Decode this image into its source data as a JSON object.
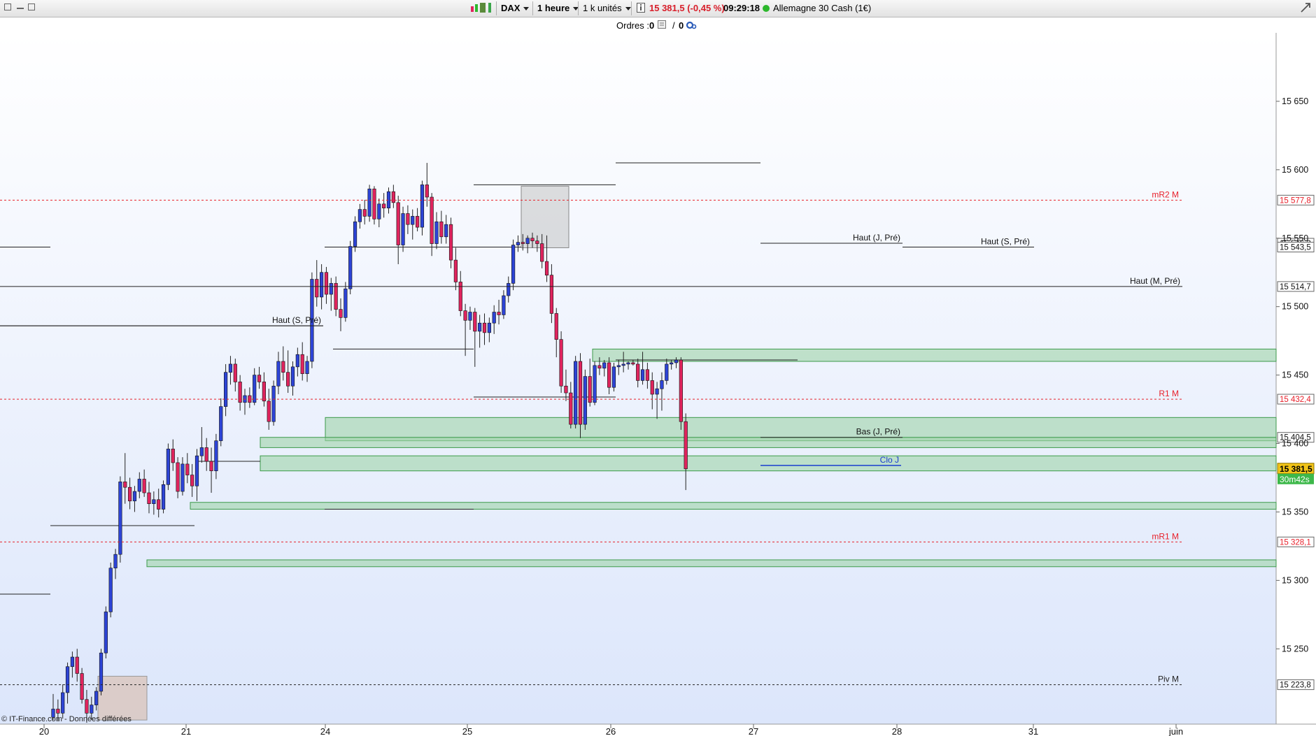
{
  "toolbar": {
    "symbol": "DAX",
    "timeframe": "1 heure",
    "units": "1 k unités",
    "price_change": "15 381,5 (-0,45 %)",
    "time": "09:29:18",
    "instrument": "Allemagne 30 Cash (1€)"
  },
  "orders": {
    "label": "Ordres :",
    "count1": "0",
    "slash": "/",
    "count2": "0"
  },
  "footer": {
    "copyright": "© IT-Finance.com - Données différées"
  },
  "colors": {
    "bull": "#2d44d6",
    "bear": "#e0245e",
    "zone": "#9fd4a8",
    "pivot_red": "#e8202a",
    "blue_line": "#1a3ecf"
  },
  "chart_data": {
    "type": "candlestick",
    "title": "",
    "ylim": [
      15195,
      15700
    ],
    "y_ticks": [
      15250,
      15300,
      15350,
      15400,
      15450,
      15500,
      15550,
      15600,
      15650
    ],
    "y_tick_labels": [
      "15 250",
      "15 300",
      "15 350",
      "15 400",
      "15 450",
      "15 500",
      "15 550",
      "15 600",
      "15 650"
    ],
    "x_tick_labels": [
      "20",
      "21",
      "24",
      "25",
      "26",
      "27",
      "28",
      "31",
      "juin"
    ],
    "current_price": {
      "value": 15381.5,
      "label": "15 381,5",
      "timer": "30m42s"
    },
    "levels": [
      {
        "name": "mR2 M",
        "value": 15577.8,
        "label": "15 577,8",
        "style": "pivot"
      },
      {
        "name": "R1 M",
        "value": 15432.4,
        "label": "15 432,4",
        "style": "pivot"
      },
      {
        "name": "mR1 M",
        "value": 15328.1,
        "label": "15 328,1",
        "style": "pivot"
      },
      {
        "name": "Piv M",
        "value": 15223.8,
        "label": "15 223,8",
        "style": "pivot_black"
      },
      {
        "name": "Haut (J, Pré)",
        "value": 15546.3,
        "label": "15 546,3",
        "style": "line"
      },
      {
        "name": "Haut (S, Pré)",
        "value": 15543.5,
        "label": "15 543,5",
        "style": "line"
      },
      {
        "name": "Haut (M, Pré)",
        "value": 15514.7,
        "label": "15 514,7",
        "style": "line"
      },
      {
        "name": "Haut (S, Pré)",
        "value": 15486,
        "label": "",
        "style": "line"
      },
      {
        "name": "Bas (J, Pré)",
        "value": 15404.5,
        "label": "15 404,5",
        "style": "line"
      },
      {
        "name": "Clo J",
        "value": 15384,
        "label": "",
        "style": "blue"
      }
    ],
    "candles": [
      {
        "o": 15200,
        "h": 15217,
        "l": 15198,
        "c": 15206
      },
      {
        "o": 15206,
        "h": 15213,
        "l": 15197,
        "c": 15203
      },
      {
        "o": 15203,
        "h": 15224,
        "l": 15199,
        "c": 15218
      },
      {
        "o": 15218,
        "h": 15240,
        "l": 15210,
        "c": 15237
      },
      {
        "o": 15237,
        "h": 15248,
        "l": 15229,
        "c": 15244
      },
      {
        "o": 15244,
        "h": 15250,
        "l": 15226,
        "c": 15232
      },
      {
        "o": 15232,
        "h": 15236,
        "l": 15210,
        "c": 15213
      },
      {
        "o": 15213,
        "h": 15220,
        "l": 15196,
        "c": 15203
      },
      {
        "o": 15203,
        "h": 15215,
        "l": 15198,
        "c": 15209
      },
      {
        "o": 15209,
        "h": 15222,
        "l": 15205,
        "c": 15219
      },
      {
        "o": 15219,
        "h": 15250,
        "l": 15216,
        "c": 15247
      },
      {
        "o": 15247,
        "h": 15281,
        "l": 15243,
        "c": 15277
      },
      {
        "o": 15277,
        "h": 15313,
        "l": 15273,
        "c": 15309
      },
      {
        "o": 15309,
        "h": 15323,
        "l": 15301,
        "c": 15319
      },
      {
        "o": 15319,
        "h": 15376,
        "l": 15313,
        "c": 15372
      },
      {
        "o": 15372,
        "h": 15393,
        "l": 15356,
        "c": 15368
      },
      {
        "o": 15368,
        "h": 15375,
        "l": 15352,
        "c": 15358
      },
      {
        "o": 15358,
        "h": 15369,
        "l": 15350,
        "c": 15365
      },
      {
        "o": 15365,
        "h": 15379,
        "l": 15360,
        "c": 15374
      },
      {
        "o": 15374,
        "h": 15381,
        "l": 15361,
        "c": 15364
      },
      {
        "o": 15364,
        "h": 15372,
        "l": 15349,
        "c": 15356
      },
      {
        "o": 15356,
        "h": 15365,
        "l": 15348,
        "c": 15359
      },
      {
        "o": 15359,
        "h": 15367,
        "l": 15346,
        "c": 15352
      },
      {
        "o": 15352,
        "h": 15373,
        "l": 15349,
        "c": 15370
      },
      {
        "o": 15370,
        "h": 15400,
        "l": 15366,
        "c": 15396
      },
      {
        "o": 15396,
        "h": 15403,
        "l": 15380,
        "c": 15386
      },
      {
        "o": 15386,
        "h": 15390,
        "l": 15360,
        "c": 15365
      },
      {
        "o": 15365,
        "h": 15390,
        "l": 15362,
        "c": 15385
      },
      {
        "o": 15385,
        "h": 15393,
        "l": 15371,
        "c": 15377
      },
      {
        "o": 15377,
        "h": 15385,
        "l": 15361,
        "c": 15369
      },
      {
        "o": 15369,
        "h": 15396,
        "l": 15358,
        "c": 15391
      },
      {
        "o": 15391,
        "h": 15412,
        "l": 15386,
        "c": 15397
      },
      {
        "o": 15397,
        "h": 15404,
        "l": 15380,
        "c": 15387
      },
      {
        "o": 15387,
        "h": 15397,
        "l": 15364,
        "c": 15380
      },
      {
        "o": 15380,
        "h": 15407,
        "l": 15374,
        "c": 15402
      },
      {
        "o": 15402,
        "h": 15433,
        "l": 15398,
        "c": 15427
      },
      {
        "o": 15427,
        "h": 15458,
        "l": 15420,
        "c": 15452
      },
      {
        "o": 15452,
        "h": 15464,
        "l": 15443,
        "c": 15458
      },
      {
        "o": 15458,
        "h": 15462,
        "l": 15438,
        "c": 15445
      },
      {
        "o": 15445,
        "h": 15450,
        "l": 15424,
        "c": 15430
      },
      {
        "o": 15430,
        "h": 15440,
        "l": 15421,
        "c": 15435
      },
      {
        "o": 15435,
        "h": 15441,
        "l": 15426,
        "c": 15430
      },
      {
        "o": 15430,
        "h": 15455,
        "l": 15428,
        "c": 15450
      },
      {
        "o": 15450,
        "h": 15456,
        "l": 15440,
        "c": 15445
      },
      {
        "o": 15445,
        "h": 15452,
        "l": 15427,
        "c": 15431
      },
      {
        "o": 15431,
        "h": 15440,
        "l": 15410,
        "c": 15416
      },
      {
        "o": 15416,
        "h": 15446,
        "l": 15413,
        "c": 15442
      },
      {
        "o": 15442,
        "h": 15467,
        "l": 15436,
        "c": 15460
      },
      {
        "o": 15460,
        "h": 15471,
        "l": 15446,
        "c": 15452
      },
      {
        "o": 15452,
        "h": 15468,
        "l": 15437,
        "c": 15442
      },
      {
        "o": 15442,
        "h": 15460,
        "l": 15435,
        "c": 15456
      },
      {
        "o": 15456,
        "h": 15470,
        "l": 15449,
        "c": 15465
      },
      {
        "o": 15465,
        "h": 15474,
        "l": 15446,
        "c": 15451
      },
      {
        "o": 15451,
        "h": 15464,
        "l": 15445,
        "c": 15460
      },
      {
        "o": 15460,
        "h": 15525,
        "l": 15455,
        "c": 15520
      },
      {
        "o": 15520,
        "h": 15534,
        "l": 15500,
        "c": 15507
      },
      {
        "o": 15507,
        "h": 15531,
        "l": 15498,
        "c": 15525
      },
      {
        "o": 15525,
        "h": 15529,
        "l": 15502,
        "c": 15509
      },
      {
        "o": 15509,
        "h": 15521,
        "l": 15497,
        "c": 15517
      },
      {
        "o": 15517,
        "h": 15522,
        "l": 15493,
        "c": 15498
      },
      {
        "o": 15498,
        "h": 15506,
        "l": 15482,
        "c": 15492
      },
      {
        "o": 15492,
        "h": 15518,
        "l": 15489,
        "c": 15513
      },
      {
        "o": 15513,
        "h": 15548,
        "l": 15509,
        "c": 15544
      },
      {
        "o": 15544,
        "h": 15566,
        "l": 15540,
        "c": 15562
      },
      {
        "o": 15562,
        "h": 15575,
        "l": 15557,
        "c": 15571
      },
      {
        "o": 15571,
        "h": 15578,
        "l": 15560,
        "c": 15566
      },
      {
        "o": 15566,
        "h": 15589,
        "l": 15562,
        "c": 15586
      },
      {
        "o": 15586,
        "h": 15588,
        "l": 15560,
        "c": 15564
      },
      {
        "o": 15564,
        "h": 15579,
        "l": 15558,
        "c": 15575
      },
      {
        "o": 15575,
        "h": 15583,
        "l": 15565,
        "c": 15572
      },
      {
        "o": 15572,
        "h": 15587,
        "l": 15568,
        "c": 15584
      },
      {
        "o": 15584,
        "h": 15589,
        "l": 15572,
        "c": 15576
      },
      {
        "o": 15576,
        "h": 15581,
        "l": 15531,
        "c": 15545
      },
      {
        "o": 15545,
        "h": 15573,
        "l": 15540,
        "c": 15568
      },
      {
        "o": 15568,
        "h": 15574,
        "l": 15553,
        "c": 15560
      },
      {
        "o": 15560,
        "h": 15571,
        "l": 15549,
        "c": 15566
      },
      {
        "o": 15566,
        "h": 15572,
        "l": 15555,
        "c": 15558
      },
      {
        "o": 15558,
        "h": 15592,
        "l": 15552,
        "c": 15589
      },
      {
        "o": 15589,
        "h": 15605,
        "l": 15573,
        "c": 15580
      },
      {
        "o": 15580,
        "h": 15583,
        "l": 15537,
        "c": 15546
      },
      {
        "o": 15546,
        "h": 15569,
        "l": 15542,
        "c": 15562
      },
      {
        "o": 15562,
        "h": 15570,
        "l": 15546,
        "c": 15551
      },
      {
        "o": 15551,
        "h": 15567,
        "l": 15546,
        "c": 15560
      },
      {
        "o": 15560,
        "h": 15565,
        "l": 15528,
        "c": 15534
      },
      {
        "o": 15534,
        "h": 15543,
        "l": 15512,
        "c": 15518
      },
      {
        "o": 15518,
        "h": 15526,
        "l": 15493,
        "c": 15497
      },
      {
        "o": 15497,
        "h": 15502,
        "l": 15464,
        "c": 15490
      },
      {
        "o": 15490,
        "h": 15500,
        "l": 15483,
        "c": 15496
      },
      {
        "o": 15496,
        "h": 15499,
        "l": 15456,
        "c": 15482
      },
      {
        "o": 15482,
        "h": 15494,
        "l": 15470,
        "c": 15488
      },
      {
        "o": 15488,
        "h": 15495,
        "l": 15472,
        "c": 15481
      },
      {
        "o": 15481,
        "h": 15492,
        "l": 15474,
        "c": 15488
      },
      {
        "o": 15488,
        "h": 15501,
        "l": 15480,
        "c": 15496
      },
      {
        "o": 15496,
        "h": 15505,
        "l": 15487,
        "c": 15494
      },
      {
        "o": 15494,
        "h": 15512,
        "l": 15491,
        "c": 15508
      },
      {
        "o": 15508,
        "h": 15522,
        "l": 15503,
        "c": 15517
      },
      {
        "o": 15517,
        "h": 15549,
        "l": 15512,
        "c": 15545
      },
      {
        "o": 15545,
        "h": 15552,
        "l": 15540,
        "c": 15547
      },
      {
        "o": 15547,
        "h": 15553,
        "l": 15541,
        "c": 15546
      },
      {
        "o": 15546,
        "h": 15552,
        "l": 15539,
        "c": 15550
      },
      {
        "o": 15550,
        "h": 15554,
        "l": 15543,
        "c": 15548
      },
      {
        "o": 15548,
        "h": 15552,
        "l": 15540,
        "c": 15546
      },
      {
        "o": 15546,
        "h": 15553,
        "l": 15528,
        "c": 15533
      },
      {
        "o": 15533,
        "h": 15552,
        "l": 15518,
        "c": 15523
      },
      {
        "o": 15523,
        "h": 15531,
        "l": 15488,
        "c": 15495
      },
      {
        "o": 15495,
        "h": 15499,
        "l": 15463,
        "c": 15476
      },
      {
        "o": 15476,
        "h": 15482,
        "l": 15437,
        "c": 15442
      },
      {
        "o": 15442,
        "h": 15454,
        "l": 15431,
        "c": 15437
      },
      {
        "o": 15437,
        "h": 15445,
        "l": 15411,
        "c": 15414
      },
      {
        "o": 15414,
        "h": 15464,
        "l": 15411,
        "c": 15460
      },
      {
        "o": 15460,
        "h": 15466,
        "l": 15404,
        "c": 15414
      },
      {
        "o": 15414,
        "h": 15454,
        "l": 15410,
        "c": 15449
      },
      {
        "o": 15449,
        "h": 15462,
        "l": 15427,
        "c": 15430
      },
      {
        "o": 15430,
        "h": 15460,
        "l": 15428,
        "c": 15457
      },
      {
        "o": 15457,
        "h": 15463,
        "l": 15450,
        "c": 15455
      },
      {
        "o": 15455,
        "h": 15461,
        "l": 15449,
        "c": 15459
      },
      {
        "o": 15459,
        "h": 15463,
        "l": 15436,
        "c": 15441
      },
      {
        "o": 15441,
        "h": 15459,
        "l": 15438,
        "c": 15456
      },
      {
        "o": 15456,
        "h": 15461,
        "l": 15450,
        "c": 15457
      },
      {
        "o": 15457,
        "h": 15467,
        "l": 15452,
        "c": 15458
      },
      {
        "o": 15458,
        "h": 15460,
        "l": 15454,
        "c": 15459
      },
      {
        "o": 15459,
        "h": 15461,
        "l": 15457,
        "c": 15458
      },
      {
        "o": 15458,
        "h": 15462,
        "l": 15441,
        "c": 15446
      },
      {
        "o": 15446,
        "h": 15467,
        "l": 15443,
        "c": 15454
      },
      {
        "o": 15454,
        "h": 15459,
        "l": 15440,
        "c": 15446
      },
      {
        "o": 15446,
        "h": 15452,
        "l": 15425,
        "c": 15436
      },
      {
        "o": 15436,
        "h": 15445,
        "l": 15418,
        "c": 15440
      },
      {
        "o": 15440,
        "h": 15452,
        "l": 15424,
        "c": 15446
      },
      {
        "o": 15446,
        "h": 15462,
        "l": 15443,
        "c": 15458
      },
      {
        "o": 15458,
        "h": 15461,
        "l": 15454,
        "c": 15459
      },
      {
        "o": 15459,
        "h": 15463,
        "l": 15455,
        "c": 15461
      },
      {
        "o": 15461,
        "h": 15463,
        "l": 15410,
        "c": 15416
      },
      {
        "o": 15416,
        "h": 15422,
        "l": 15366,
        "c": 15381.5
      }
    ]
  }
}
